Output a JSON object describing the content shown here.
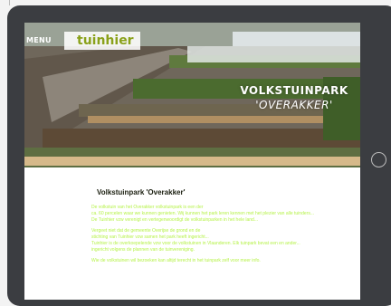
{
  "nav": {
    "menu_label": "MENU"
  },
  "logo": {
    "small_text": "",
    "main_text": "tuinhier",
    "sub_text": ""
  },
  "hero": {
    "title_line1": "VOLKSTUINPARK",
    "title_line2": "'OVERAKKER'"
  },
  "content": {
    "title": "Volkstuinpark 'Overakker'",
    "paragraphs": [
      {
        "lines": [
          "De volkstuin van het Overakker volkstuinpark is een der",
          "ca. 60 percelen waar we kunnen genieten. Wij kunnen het park leren kennen met het plezier van alle tuinders...",
          "De Tuinhier vzw verenigt en vertegenwoordigt de volkstuinparken in het hele land..."
        ]
      },
      {
        "lines": [
          "Vergeet niet dat de gemeente Overijse de grond en de",
          "stichting van Tuinhier vzw samen het park heeft ingericht...",
          "Tuinhier is de overkoepelende vzw voor de volkstuinen in Vlaanderen. Elk tuinpark bevat een en ander...",
          "ingericht volgens de plannen van de tuinvereniging."
        ]
      },
      {
        "lines": [
          "Wie de volkstuinen wil bezoeken kan altijd terecht in het tuinpark zelf voor meer info."
        ]
      }
    ]
  },
  "colors": {
    "bezel": "#3b3d41",
    "body_text": "#b6f24a",
    "title_text": "#1b1f10",
    "logo_green": "#8aa11a"
  }
}
